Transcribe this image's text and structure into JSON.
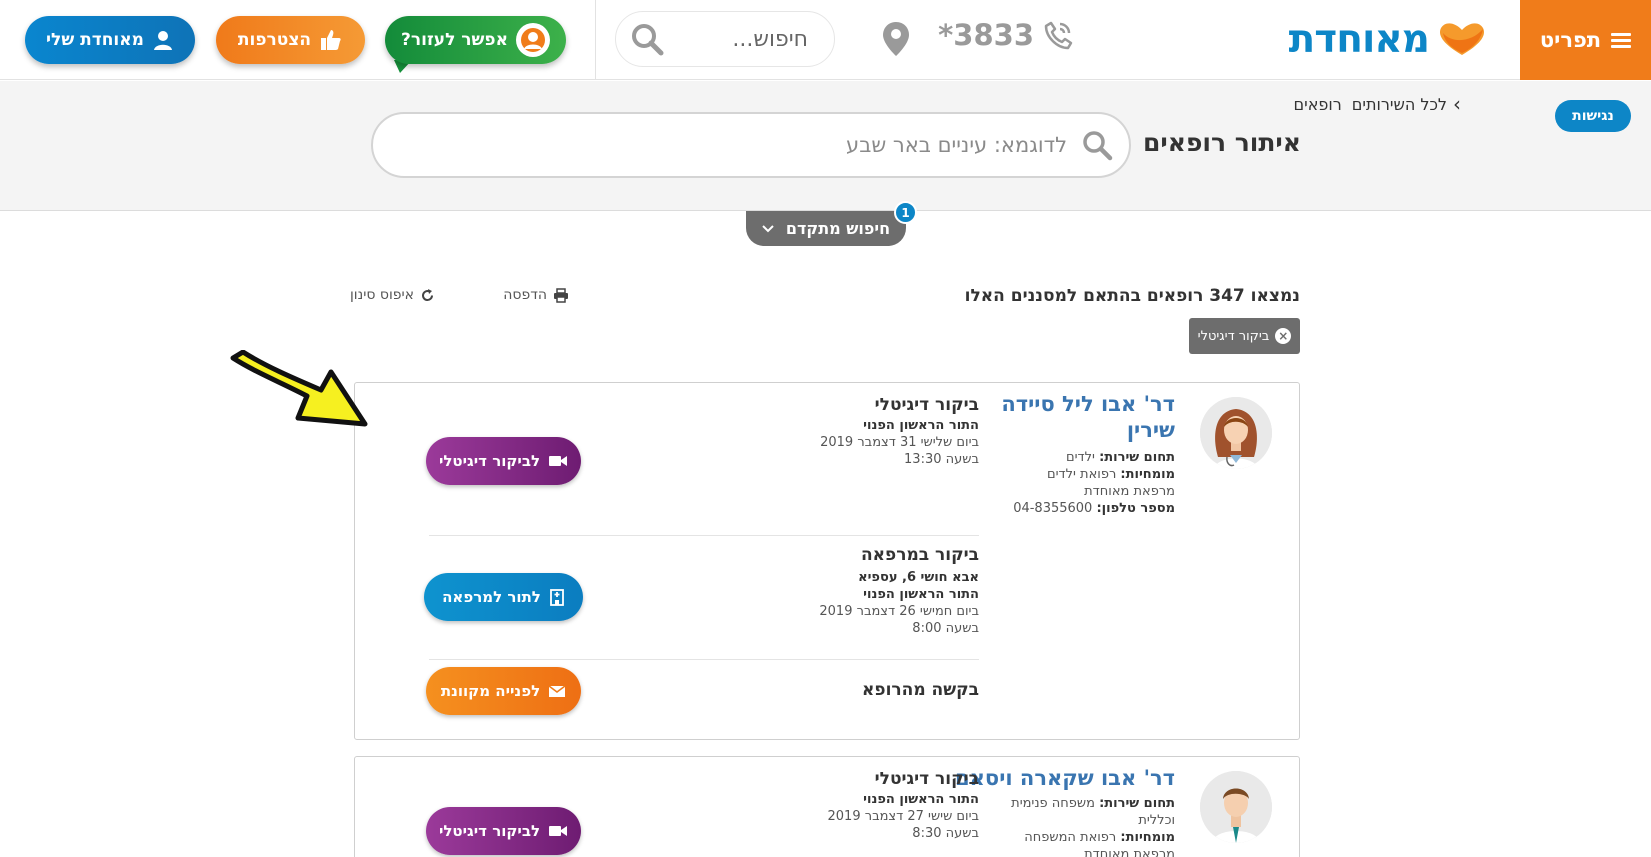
{
  "header": {
    "menu_label": "תפריט",
    "logo_text": "מאוחדת",
    "phone": "3833*",
    "search_placeholder": "חיפוש...",
    "help_label": "אפשר לעזור?",
    "join_label": "הצטרפות",
    "mine_label": "מאוחדת שלי"
  },
  "accessibility_label": "נגישות",
  "breadcrumb": [
    "לכל השירותים",
    "רופאים"
  ],
  "page_title": "איתור רופאים",
  "main_search": {
    "placeholder": "לדוגמא: עיניים באר שבע",
    "value": ""
  },
  "advanced_search": {
    "label": "חיפוש מתקדם",
    "badge": "1"
  },
  "results": {
    "count_text": "נמצאו 347 רופאים בהתאם למסננים האלו",
    "print_label": "הדפסה",
    "reset_label": "איפוס סינון",
    "active_filter": "ביקור דיגיטלי"
  },
  "doctors": [
    {
      "name_line1": "דר' אבו ליל סיידה",
      "name_line2": "שירין",
      "field_label": "תחום שירות:",
      "field_value": "ילדים",
      "specialty_label": "מומחיות:",
      "specialty_value": "רפואת ילדים",
      "clinic": "מרפאת מאוחדת",
      "phone_label": "מספר טלפון:",
      "phone_value": "04-8355600",
      "digital": {
        "title": "ביקור דיגיטלי",
        "first_label": "התור הראשון הפנוי",
        "date": "ביום שלישי 31 דצמבר 2019",
        "time": "בשעה 13:30",
        "button": "לביקור דיגיטלי"
      },
      "clinic_visit": {
        "title": "ביקור במרפאה",
        "address": "אבא חושי 6, עספיא",
        "first_label": "התור הראשון הפנוי",
        "date": "ביום חמישי 26 דצמבר 2019",
        "time": "בשעה 8:00",
        "button": "לתור למרפאה"
      },
      "request": {
        "title": "בקשה מהרופא",
        "button": "לפנייה מקוונת"
      }
    },
    {
      "name_line1": "דר' אבו שקארה ויסאם",
      "field_label": "תחום שירות:",
      "field_value": "משפחה פנימית",
      "field_value2": "וכללית",
      "specialty_label": "מומחיות:",
      "specialty_value": "רפואת המשפחה",
      "clinic": "מרפאת מאוחדת",
      "digital": {
        "title": "ביקור דיגיטלי",
        "first_label": "התור הראשון הפנוי",
        "date": "ביום שישי 27 דצמבר 2019",
        "time": "בשעה 8:30",
        "button": "לביקור דיגיטלי"
      }
    }
  ],
  "colors": {
    "orange": "#f07c1a",
    "blue": "#0d86c7",
    "green": "#138b3a",
    "purple": "#7b2580",
    "annotation_arrow": "#f6f020"
  }
}
